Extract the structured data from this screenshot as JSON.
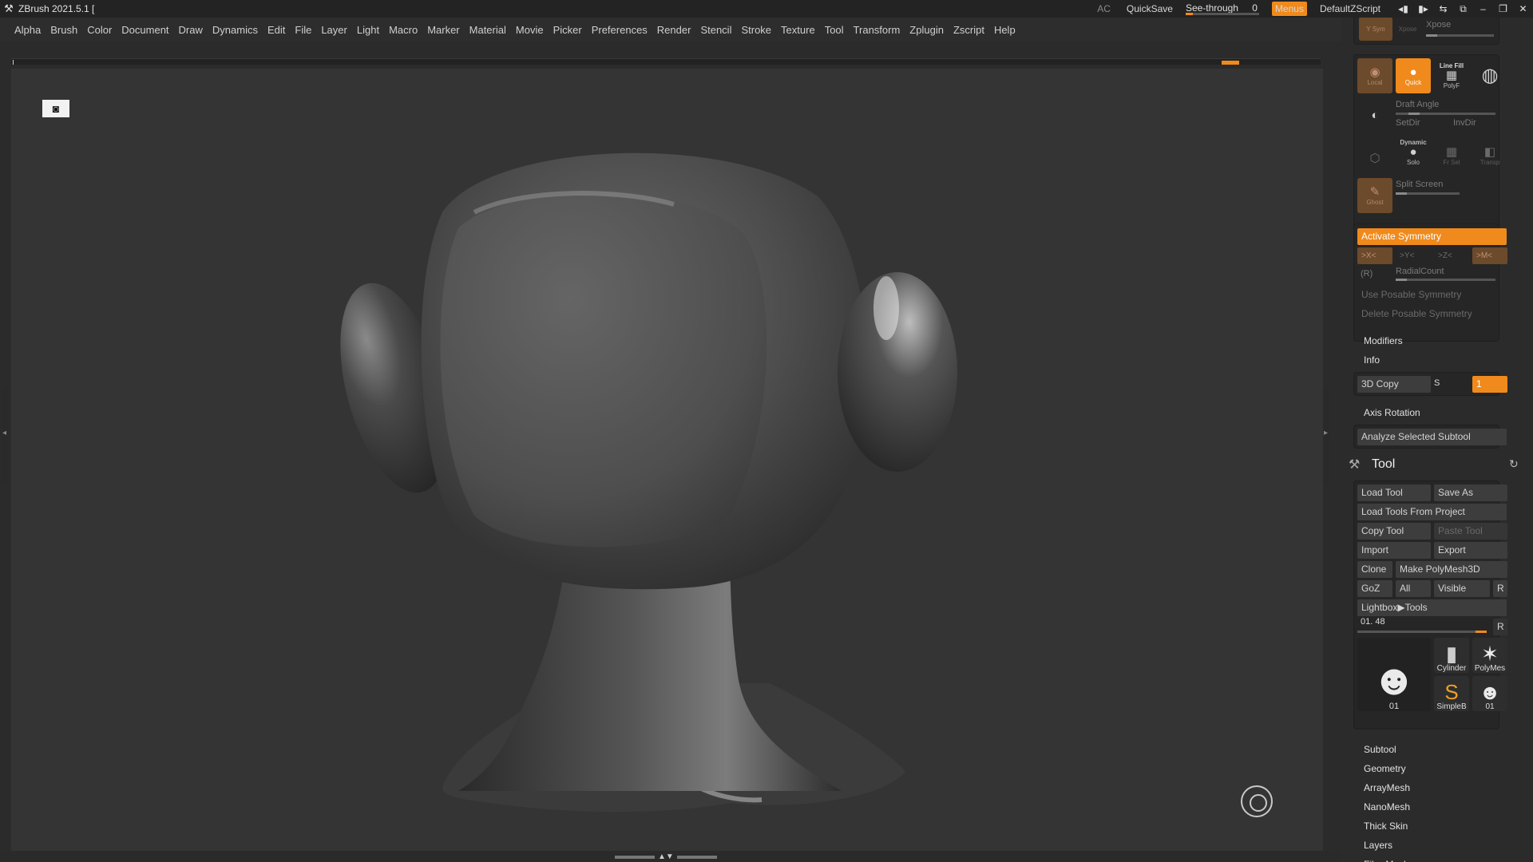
{
  "titlebar": {
    "app_title": "ZBrush 2021.5.1 [",
    "ac": "AC",
    "quicksave": "QuickSave",
    "seethrough_label": "See-through",
    "seethrough_value": "0",
    "menus": "Menus",
    "script": "DefaultZScript"
  },
  "menubar": [
    "Alpha",
    "Brush",
    "Color",
    "Document",
    "Draw",
    "Dynamics",
    "Edit",
    "File",
    "Layer",
    "Light",
    "Macro",
    "Marker",
    "Material",
    "Movie",
    "Picker",
    "Preferences",
    "Render",
    "Stencil",
    "Stroke",
    "Texture",
    "Tool",
    "Transform",
    "Zplugin",
    "Zscript",
    "Help"
  ],
  "panel": {
    "top_strip": {
      "ysym": "Y Sym",
      "xpose": "Xpose",
      "xpose_label": "Xpose"
    },
    "draw_group": {
      "local": "Local",
      "quick": "Quick",
      "line_fill": "Line Fill",
      "polyf": "PolyF",
      "draft_angle": "Draft Angle",
      "setdir": "SetDir",
      "invdir": "InvDir",
      "dynamic": "Dynamic",
      "solo": "Solo",
      "frsel": "Fr Sel",
      "transp": "Transp",
      "ghost": "Ghost",
      "split_screen": "Split Screen"
    },
    "symmetry": {
      "activate": "Activate Symmetry",
      "x": ">X<",
      "y": ">Y<",
      "z": ">Z<",
      "m": ">M<",
      "r": "(R)",
      "radial": "RadialCount",
      "use_posable": "Use Posable Symmetry",
      "delete_posable": "Delete Posable Symmetry"
    },
    "modifiers": "Modifiers",
    "info": "Info",
    "copy3d": {
      "label": "3D Copy",
      "s": "S",
      "value": "1"
    },
    "axis_rotation": "Axis Rotation",
    "analyze": "Analyze Selected Subtool",
    "tool": {
      "title": "Tool",
      "load_tool": "Load Tool",
      "save_as": "Save As",
      "load_from_project": "Load Tools From Project",
      "copy_tool": "Copy Tool",
      "paste_tool": "Paste Tool",
      "import": "Import",
      "export": "Export",
      "clone": "Clone",
      "make_polymesh": "Make PolyMesh3D",
      "goz": "GoZ",
      "all": "All",
      "visible": "Visible",
      "r": "R",
      "lightbox": "Lightbox▶Tools",
      "current": "01. 48",
      "current_r": "R",
      "thumbs": {
        "main": "01",
        "cylinder": "Cylinder",
        "polymesh": "PolyMes",
        "simpleb": "SimpleB",
        "small": "01"
      }
    },
    "subpalettes": [
      "Subtool",
      "Geometry",
      "ArrayMesh",
      "NanoMesh",
      "Thick Skin",
      "Layers",
      "FiberMesh"
    ]
  },
  "colors": {
    "accent": "#f08a1c",
    "panel": "#2b2b2b",
    "viewport": "#343434"
  },
  "icons": {
    "logo": "zbrush-logo-icon",
    "persp": "perspective-head-icon",
    "tool": "hammer-icon",
    "refresh": "refresh-icon"
  },
  "seethrough_level": 0.1
}
